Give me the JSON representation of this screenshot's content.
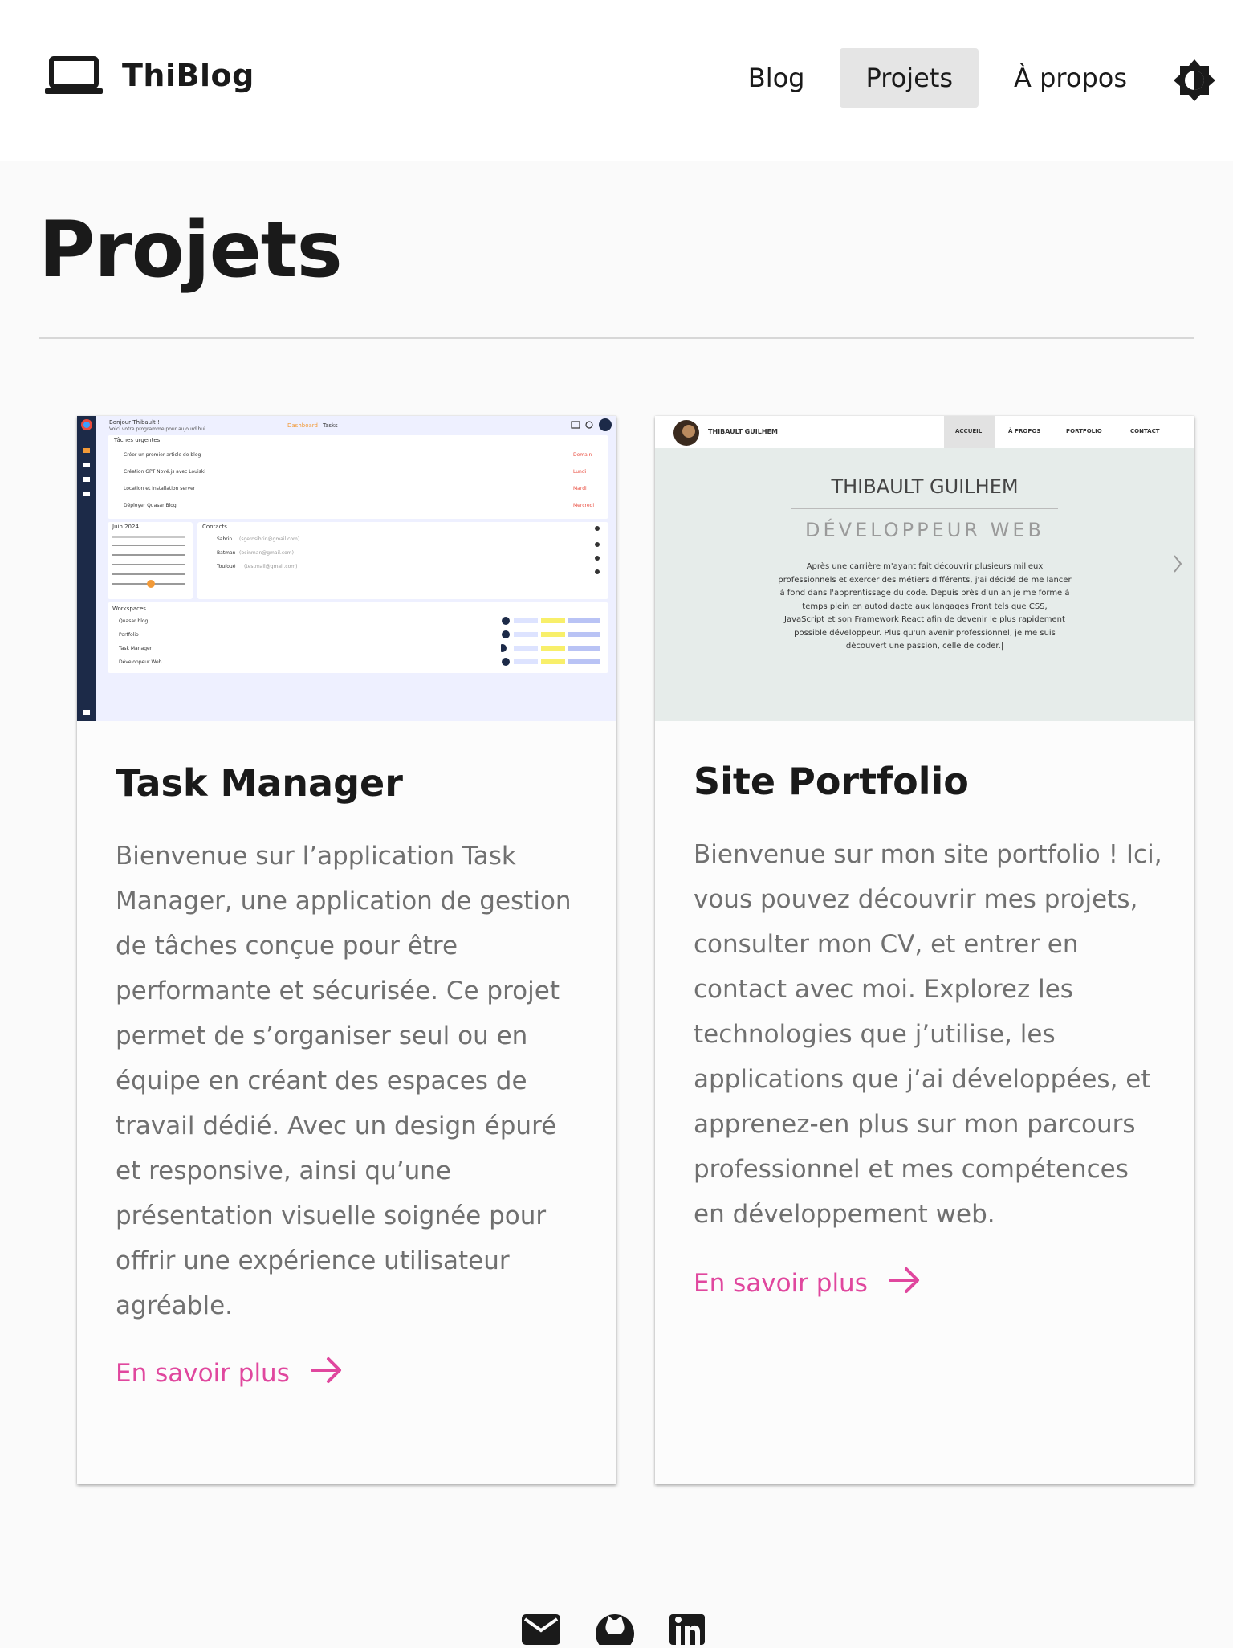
{
  "header": {
    "brand": "ThiBlog",
    "nav": [
      "Blog",
      "Projets",
      "À propos"
    ],
    "active_nav": "Projets"
  },
  "page": {
    "title": "Projets"
  },
  "projects": [
    {
      "title": "Task Manager",
      "description": "Bienvenue sur l’application Task Manager, une application de gestion de tâches conçue pour être performante et sécurisée. Ce projet permet de s’organiser seul ou en équipe en créant des espaces de travail dédié. Avec un design épuré et responsive, ainsi qu’une présentation visuelle soignée pour offrir une expérience utilisateur agréable.",
      "link_label": "En savoir plus",
      "screenshot": {
        "greeting": "Bonjour Thibault !",
        "sub": "Voici votre programme pour aujourd'hui",
        "tab_active": "Dashboard",
        "tab": "Tasks",
        "urgent_title": "Tâches urgentes",
        "urgent": [
          {
            "label": "Créer un premier article de blog",
            "when": "Demain"
          },
          {
            "label": "Création GPT Nové.js avec Louiski",
            "when": "Lundi"
          },
          {
            "label": "Location et installation server",
            "when": "Mardi"
          },
          {
            "label": "Déployer Quasar Blog",
            "when": "Mercredi"
          }
        ],
        "calendar_title": "Juin 2024",
        "contacts_title": "Contacts",
        "contacts": [
          {
            "name": "Sabrin",
            "email": "(sgerosibrin@gmail.com)"
          },
          {
            "name": "Batman",
            "email": "(bcinman@gmail.com)"
          },
          {
            "name": "Toufoué",
            "email": "(testmail@gmail.com)"
          }
        ],
        "workspaces_title": "Workspaces",
        "workspaces": [
          "Quasar blog",
          "Portfolio",
          "Task Manager",
          "Développeur Web"
        ]
      }
    },
    {
      "title": "Site Portfolio",
      "description": "Bienvenue sur mon site portfolio ! Ici, vous pouvez découvrir mes projets, consulter mon CV, et entrer en contact avec moi. Explorez les technologies que j’utilise, les applications que j’ai développées, et apprenez-en plus sur mon parcours professionnel et mes compétences en développement web.",
      "link_label": "En savoir plus",
      "screenshot": {
        "brand": "THIBAULT GUILHEM",
        "nav": [
          "ACCUEIL",
          "À PROPOS",
          "PORTFOLIO",
          "CONTACT"
        ],
        "name": "THIBAULT GUILHEM",
        "role": "DÉVELOPPEUR WEB",
        "bio_lines": [
          "Après une carrière m'ayant fait découvrir plusieurs milieux",
          "professionnels et exercer des métiers différents, j'ai décidé de me lancer",
          "à fond dans l'apprentissage du code. Depuis près d'un an je me forme à",
          "temps plein en autodidacte aux langages Front tels que CSS,",
          "JavaScript et son Framework React afin de devenir le plus rapidement",
          "possible développeur. Plus qu'un avenir professionnel, je me suis",
          "découvert une passion, celle de coder.|"
        ]
      }
    }
  ],
  "footer": {
    "icons": [
      "mail-icon",
      "github-icon",
      "linkedin-icon"
    ]
  },
  "colors": {
    "accent": "#e0479e",
    "text_muted": "#707070",
    "active_nav_bg": "#e5e5e5"
  }
}
